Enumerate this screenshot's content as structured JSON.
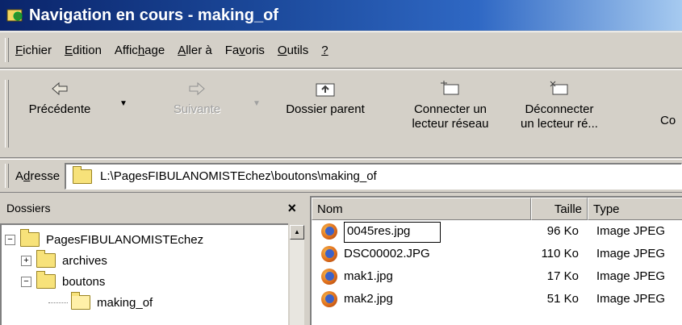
{
  "window": {
    "title": "Navigation en cours - making_of"
  },
  "menu": [
    {
      "label": "Fichier",
      "key": "F",
      "rest": "ichier"
    },
    {
      "label": "Edition",
      "key": "E",
      "rest": "dition"
    },
    {
      "label": "Affichage",
      "pre": "Affic",
      "key": "h",
      "rest": "age"
    },
    {
      "label": "Aller à",
      "key": "A",
      "rest": "ller à"
    },
    {
      "label": "Favoris",
      "pre": "Fa",
      "key": "v",
      "rest": "oris"
    },
    {
      "label": "Outils",
      "key": "O",
      "rest": "utils"
    },
    {
      "label": "?",
      "key": "?",
      "rest": ""
    }
  ],
  "toolbar": {
    "back": "Précédente",
    "forward": "Suivante",
    "parent": "Dossier parent",
    "connect_1": "Connecter un",
    "connect_2": "lecteur réseau",
    "disconnect_1": "Déconnecter",
    "disconnect_2": "un lecteur ré...",
    "more": "Co"
  },
  "address": {
    "label_pre": "A",
    "label_key": "d",
    "label_rest": "resse",
    "value": "L:\\PagesFIBULANOMISTEchez\\boutons\\making_of"
  },
  "folders_pane": {
    "title": "Dossiers",
    "close": "×",
    "tree": [
      {
        "label": "PagesFIBULANOMISTEchez",
        "expander": "−"
      },
      {
        "label": "archives",
        "expander": "+"
      },
      {
        "label": "boutons",
        "expander": "−"
      },
      {
        "label": "making_of",
        "expander": ""
      }
    ]
  },
  "files": {
    "columns": {
      "name": "Nom",
      "size": "Taille",
      "type": "Type"
    },
    "rows": [
      {
        "name": "0045res.jpg",
        "size": "96 Ko",
        "type": "Image JPEG",
        "renaming": true
      },
      {
        "name": "DSC00002.JPG",
        "size": "110 Ko",
        "type": "Image JPEG"
      },
      {
        "name": "mak1.jpg",
        "size": "17 Ko",
        "type": "Image JPEG"
      },
      {
        "name": "mak2.jpg",
        "size": "51 Ko",
        "type": "Image JPEG"
      }
    ]
  }
}
